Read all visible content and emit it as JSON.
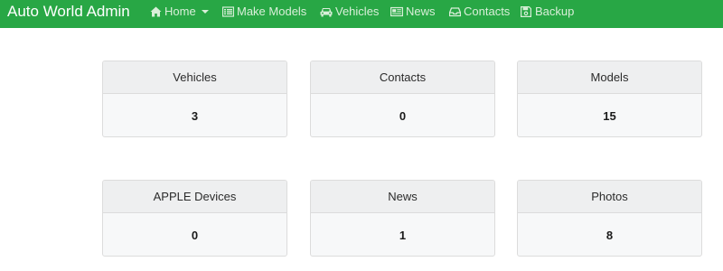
{
  "navbar": {
    "brand": "Auto World Admin",
    "items": [
      {
        "label": "Home",
        "icon": "home-icon",
        "has_dropdown": true
      },
      {
        "label": "Make Models",
        "icon": "list-icon"
      },
      {
        "label": "Vehicles",
        "icon": "car-icon"
      },
      {
        "label": "News",
        "icon": "newspaper-icon"
      },
      {
        "label": "Contacts",
        "icon": "inbox-icon"
      },
      {
        "label": "Backup",
        "icon": "save-icon"
      }
    ],
    "colors": {
      "background": "#28a745",
      "link": "#d9efd9",
      "brand": "#ffffff"
    }
  },
  "cards": [
    {
      "title": "Vehicles",
      "value": "3"
    },
    {
      "title": "Contacts",
      "value": "0"
    },
    {
      "title": "Models",
      "value": "15"
    },
    {
      "title": "APPLE Devices",
      "value": "0"
    },
    {
      "title": "News",
      "value": "1"
    },
    {
      "title": "Photos",
      "value": "8"
    }
  ]
}
